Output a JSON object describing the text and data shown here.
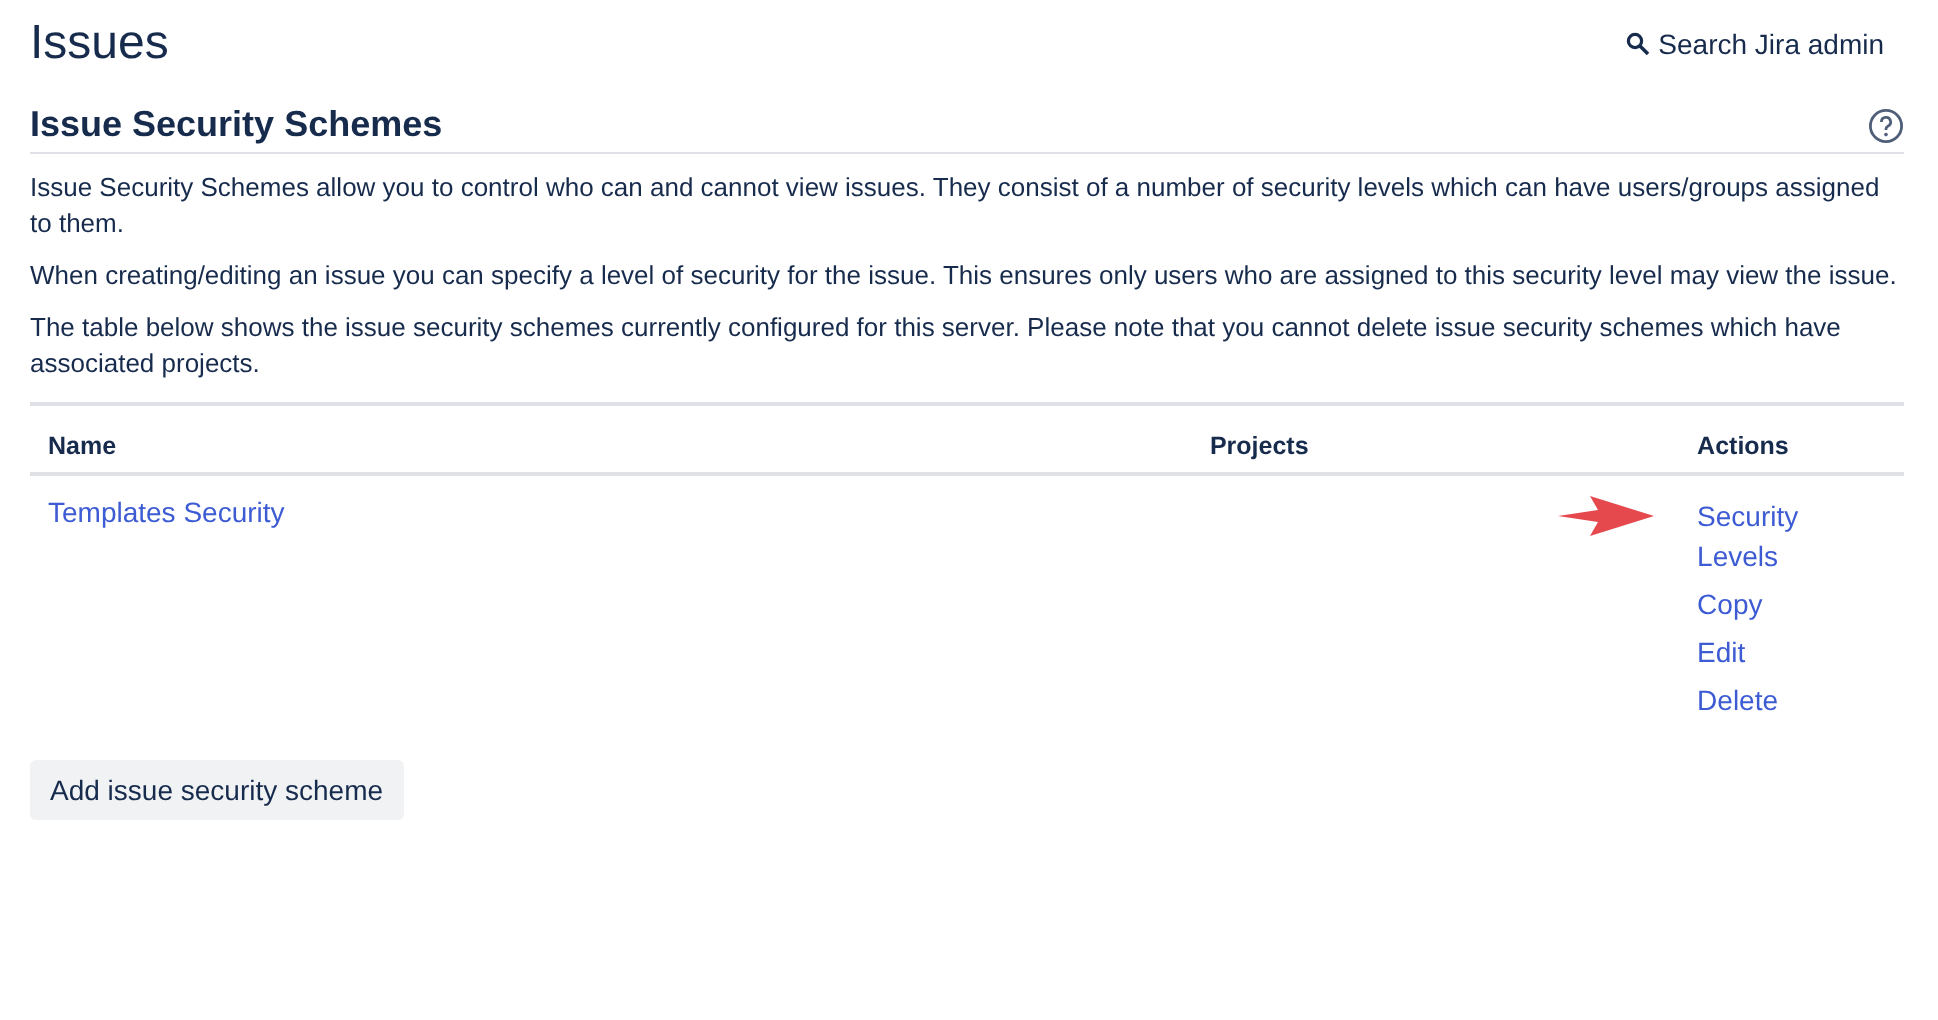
{
  "page": {
    "title": "Issues",
    "search_link": "Search Jira admin"
  },
  "section": {
    "title": "Issue Security Schemes"
  },
  "paragraphs": [
    "Issue Security Schemes allow you to control who can and cannot view issues. They consist of a number of security levels which can have users/groups assigned to them.",
    "When creating/editing an issue you can specify a level of security for the issue. This ensures only users who are assigned to this security level may view the issue.",
    "The table below shows the issue security schemes currently configured for this server. Please note that you cannot delete issue security schemes which have associated projects."
  ],
  "table": {
    "columns": [
      "Name",
      "Projects",
      "Actions"
    ],
    "rows": [
      {
        "name": "Templates Security",
        "actions": [
          "Security Levels",
          "Copy",
          "Edit",
          "Delete"
        ]
      }
    ]
  },
  "add_button": "Add issue security scheme"
}
